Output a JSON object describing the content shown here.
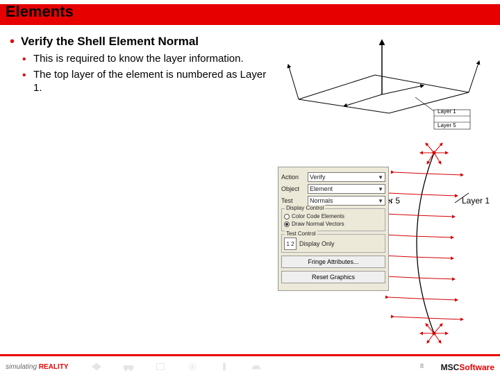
{
  "title": "Elements",
  "bullets": {
    "heading": "Verify the Shell Element Normal",
    "items": [
      "This is required to know the layer information.",
      "The top layer of the element is numbered as Layer 1."
    ]
  },
  "panel": {
    "rows": {
      "action": {
        "label": "Action",
        "value": "Verify"
      },
      "object": {
        "label": "Object",
        "value": "Element"
      },
      "test": {
        "label": "Test",
        "value": "Normals"
      }
    },
    "display_control": {
      "legend": "Display Control",
      "opt1": "Color Code Elements",
      "opt2": "Draw Normal Vectors"
    },
    "test_control": {
      "legend": "Test Control",
      "guide": "1 2",
      "display_only": "Display Only"
    },
    "buttons": {
      "fringe": "Fringe Attributes...",
      "reset": "Reset Graphics"
    }
  },
  "diagram_right": {
    "layer5": "Layer 5",
    "layer1": "Layer 1"
  },
  "diagram_top": {
    "layer1_tag": "Layer 1",
    "layer5_tag": "Layer 5"
  },
  "footer": {
    "tagline_sim": "simulating",
    "tagline_real": "REALITY",
    "page": "8",
    "logo_m": "MSC",
    "logo_s": "Software"
  }
}
